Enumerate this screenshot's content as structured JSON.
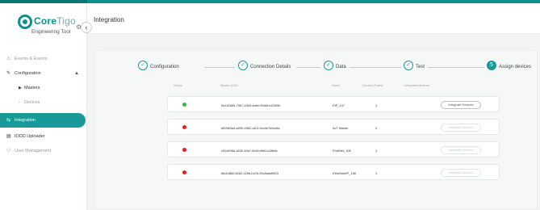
{
  "brand": {
    "name_core": "Core",
    "name_rest": "Tigo",
    "subtitle": "Engineering Tool"
  },
  "sidebar": {
    "items": [
      {
        "label": "Events & Events"
      },
      {
        "label": "Configuration"
      },
      {
        "label": "Masters"
      },
      {
        "label": "Devices"
      },
      {
        "label": "Integration"
      },
      {
        "label": "IODD Uploader"
      },
      {
        "label": "User Management"
      }
    ]
  },
  "header": {
    "title": "Integration"
  },
  "stepper": [
    {
      "label": "Configuration",
      "index": "✓"
    },
    {
      "label": "Connection Details",
      "index": "✓"
    },
    {
      "label": "Data",
      "index": "✓"
    },
    {
      "label": "Test",
      "index": "✓"
    },
    {
      "label": "Assign devices",
      "index": "5"
    }
  ],
  "table": {
    "headers": [
      "Status",
      "Master UUID",
      "Name",
      "Devices Polled",
      "Integrated devices"
    ],
    "rows": [
      {
        "status": "online",
        "uuid": "5d140d59-7067-4309-8dee-f94d61d2309b",
        "name": "EIP_137",
        "devices": "1",
        "action": "Integrate Devices",
        "enabled": true
      },
      {
        "status": "offline",
        "uuid": "df53f63a4-a090-4962-af13-9ce4e7b0ca6c",
        "name": "IIoT Master",
        "devices": "0",
        "action": "Integrate Devices",
        "enabled": false
      },
      {
        "status": "offline",
        "uuid": "c51d598a-4830-40a7-8b40-ff6e1c43fefa",
        "name": "ProfiNet_100",
        "devices": "1",
        "action": "Integrate Devices",
        "enabled": false
      },
      {
        "status": "offline",
        "uuid": "f6b40860-8062-4296-b476-99c5adbff603",
        "name": "EtherNet/IP_138",
        "devices": "1",
        "action": "Integrate Devices",
        "enabled": false
      }
    ]
  },
  "colors": {
    "accent": "#1a9a96",
    "online": "#3bb34a",
    "offline": "#e0201f"
  },
  "icons": [
    "gear-icon",
    "chevron-left-icon",
    "chevron-up-icon",
    "check-icon"
  ]
}
